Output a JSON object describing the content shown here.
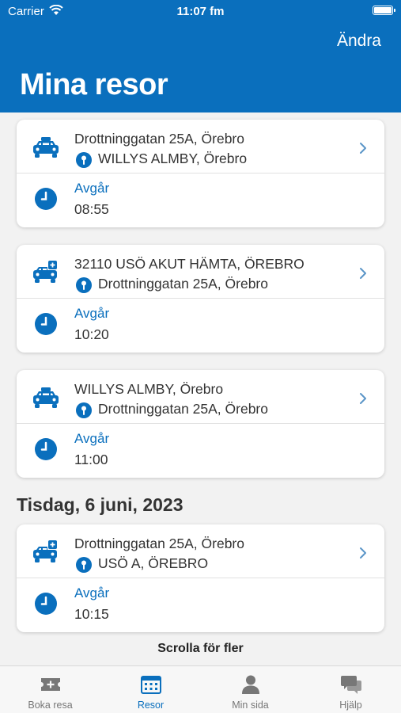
{
  "status_bar": {
    "carrier": "Carrier",
    "time": "11:07 fm"
  },
  "header": {
    "edit_label": "Ändra",
    "title": "Mina resor"
  },
  "trips": [
    {
      "vehicle": "taxi-icon",
      "from": "Drottninggatan 25A, Örebro",
      "to": "WILLYS ALMBY, Örebro",
      "departure_label": "Avgår",
      "departure_time": "08:55"
    },
    {
      "vehicle": "medical-taxi-icon",
      "from": "32110 USÖ AKUT HÄMTA, ÖREBRO",
      "to": "Drottninggatan 25A, Örebro",
      "departure_label": "Avgår",
      "departure_time": "10:20"
    },
    {
      "vehicle": "taxi-icon",
      "from": "WILLYS ALMBY, Örebro",
      "to": "Drottninggatan 25A, Örebro",
      "departure_label": "Avgår",
      "departure_time": "11:00"
    },
    {
      "vehicle": "medical-taxi-icon",
      "from": "Drottninggatan 25A, Örebro",
      "to": "USÖ A, ÖREBRO",
      "departure_label": "Avgår",
      "departure_time": "10:15"
    }
  ],
  "date_section": "Tisdag, 6 juni, 2023",
  "scroll_hint": "Scrolla för fler",
  "tabbar": {
    "active": "Resor",
    "tabs": [
      {
        "label": "Boka resa",
        "icon": "ticket-plus-icon"
      },
      {
        "label": "Resor",
        "icon": "calendar-icon"
      },
      {
        "label": "Min sida",
        "icon": "person-icon"
      },
      {
        "label": "Hjälp",
        "icon": "chat-bubbles-icon"
      }
    ]
  },
  "colors": {
    "brand": "#0a6fbd",
    "background": "#f2f2f2",
    "card": "#ffffff",
    "inactive": "#777777"
  }
}
